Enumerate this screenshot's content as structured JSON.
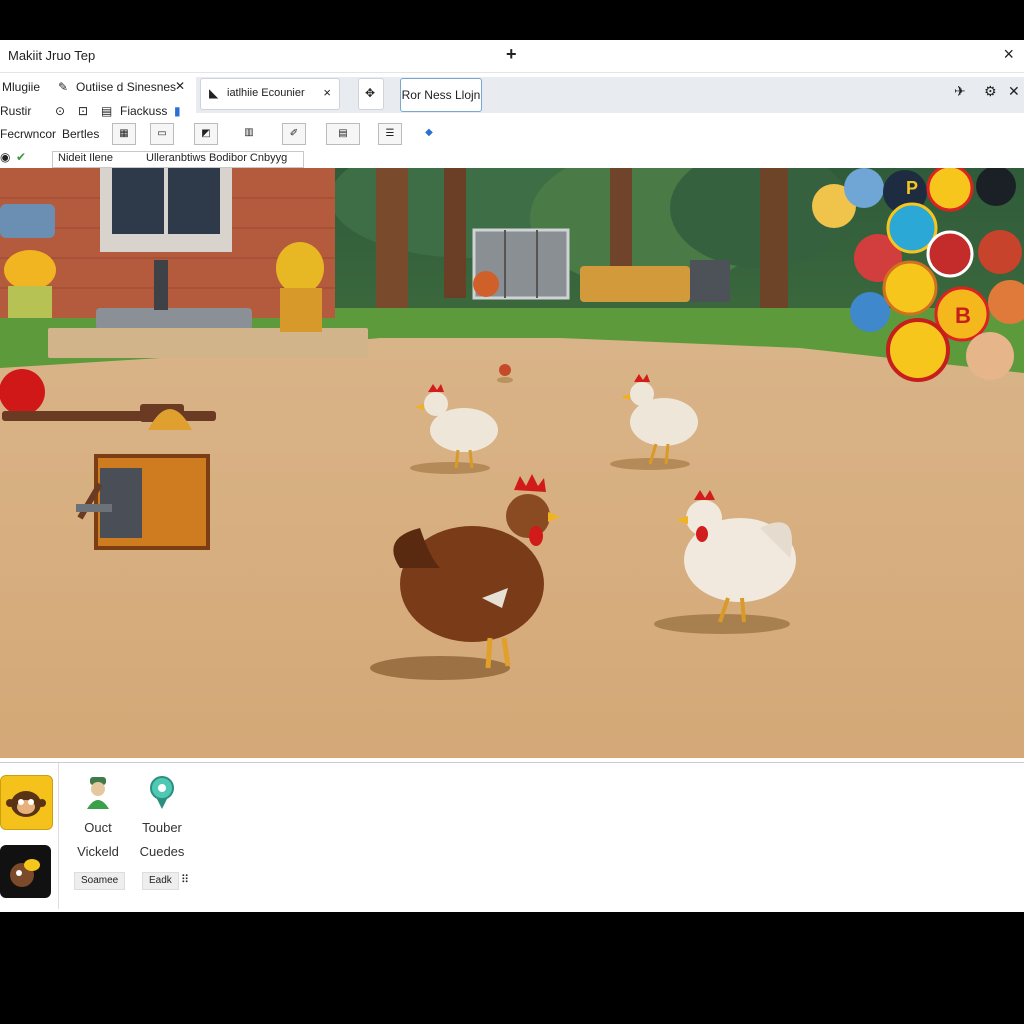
{
  "window": {
    "title": "Makiit Jruo Tep",
    "new_tab_symbol": "+",
    "close_symbol": "×"
  },
  "tabs_row": {
    "left_lines": {
      "line1_a": "Mlugiie",
      "line1_b": "Outiise d Sinesnes",
      "line2_a": "Rustir",
      "line2_b": "Fiackuss"
    },
    "tab_label": "iatlhiie Ecounier",
    "tab_close": "×",
    "new_tab_label": "Ror Ness Llojn"
  },
  "toolbar": {
    "label_a": "Fecrwncor",
    "label_b": "Bertles"
  },
  "address": {
    "label_a": "Nideit Ilene",
    "label_b": "Ulleranbtiws Bodibor Cnbyyg"
  },
  "panel": {
    "tools": [
      {
        "line1": "Ouct",
        "line2": "Vickeld"
      },
      {
        "line1": "Touber",
        "line2": "Cuedes"
      }
    ],
    "chips": [
      "Soamee",
      "Eadk"
    ]
  },
  "scene_badge_letters": [
    "P",
    "B"
  ],
  "icons": [
    "plus-icon",
    "close-icon",
    "pin-icon",
    "extensions-icon",
    "menu-icon"
  ],
  "colors": {
    "dirt": "#d7ae7e",
    "grass": "#5d9a3c",
    "brick": "#b45b3e",
    "panel": "#ffffff",
    "accent_yellow": "#f4c21b"
  }
}
